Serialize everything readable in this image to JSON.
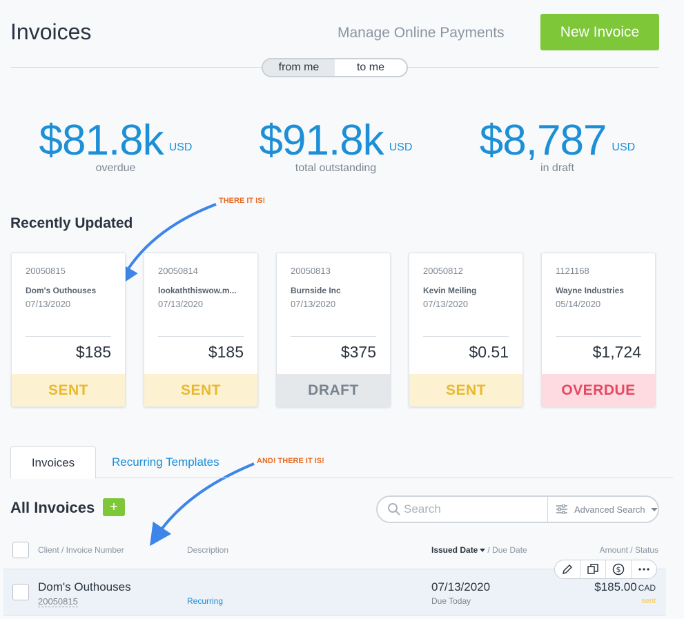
{
  "header": {
    "title": "Invoices",
    "manage_payments": "Manage Online Payments",
    "new_invoice": "New Invoice",
    "toggle": {
      "from_me": "from me",
      "to_me": "to me",
      "selected": "from me"
    }
  },
  "stats": [
    {
      "amount": "$81.8k",
      "unit": "USD",
      "label": "overdue"
    },
    {
      "amount": "$91.8k",
      "unit": "USD",
      "label": "total outstanding"
    },
    {
      "amount": "$8,787",
      "unit": "USD",
      "label": "in draft"
    }
  ],
  "annotations": {
    "first": "THERE IT IS!",
    "second": "AND! THERE IT IS!"
  },
  "recent": {
    "title": "Recently Updated",
    "cards": [
      {
        "number": "20050815",
        "client": "Dom's Outhouses",
        "date": "07/13/2020",
        "amount": "$185",
        "status": "SENT"
      },
      {
        "number": "20050814",
        "client": "lookaththiswow.m...",
        "date": "07/13/2020",
        "amount": "$185",
        "status": "SENT"
      },
      {
        "number": "20050813",
        "client": "Burnside Inc",
        "date": "07/13/2020",
        "amount": "$375",
        "status": "DRAFT"
      },
      {
        "number": "20050812",
        "client": "Kevin Meiling",
        "date": "07/13/2020",
        "amount": "$0.51",
        "status": "SENT"
      },
      {
        "number": "1121168",
        "client": "Wayne Industries",
        "date": "05/14/2020",
        "amount": "$1,724",
        "status": "OVERDUE"
      }
    ]
  },
  "tabs": {
    "invoices": "Invoices",
    "recurring": "Recurring Templates"
  },
  "list": {
    "title": "All Invoices",
    "add": "+",
    "search_placeholder": "Search",
    "advanced_search": "Advanced Search",
    "columns": {
      "client": "Client / Invoice Number",
      "description": "Description",
      "issued": "Issued Date",
      "due": "/ Due Date",
      "amount": "Amount / Status"
    },
    "rows": [
      {
        "client": "Dom's Outhouses",
        "number": "20050815",
        "description": "Recurring",
        "issued": "07/13/2020",
        "due": "Due Today",
        "amount": "$185.00",
        "currency": "CAD",
        "status": "sent"
      }
    ]
  },
  "colors": {
    "accent": "#1c8fd6",
    "primary_button": "#7dc738",
    "annotation": "#e86a22",
    "arrow": "#3d85e8"
  }
}
